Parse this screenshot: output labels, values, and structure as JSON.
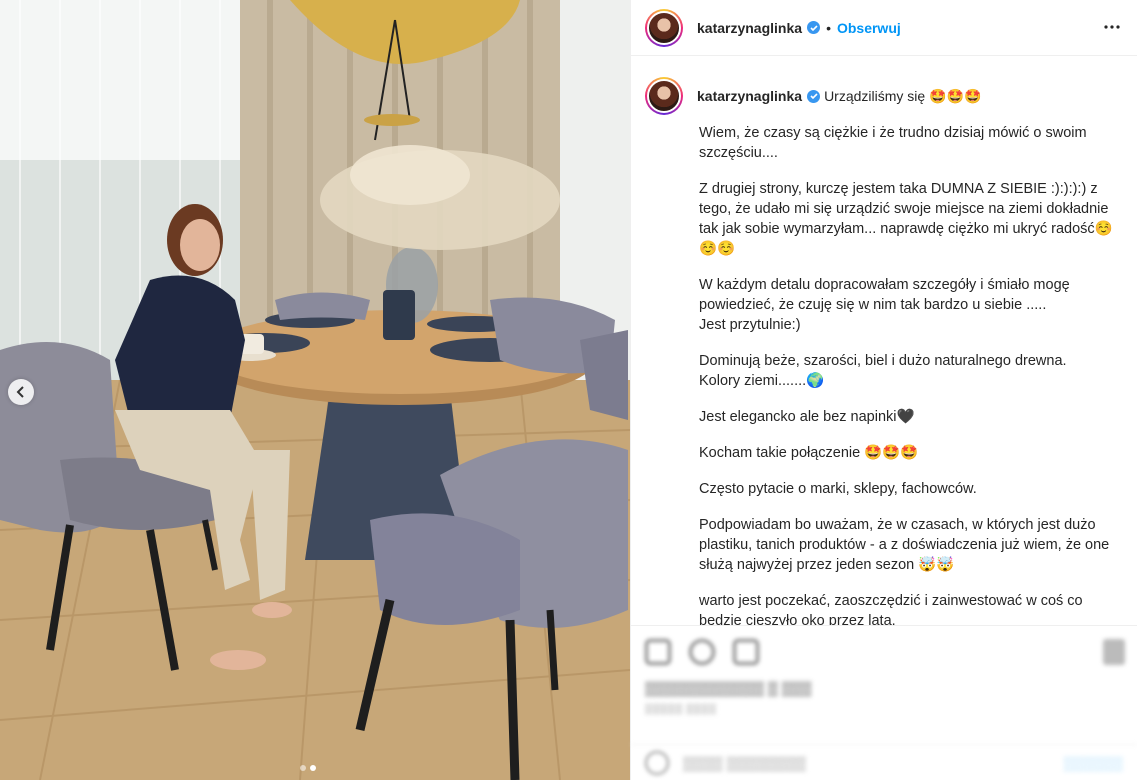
{
  "post": {
    "username": "katarzynaglinka",
    "verified": true,
    "separator": "•",
    "follow_label": "Obserwuj",
    "more_icon": "more-horizontal-icon"
  },
  "caption": {
    "username": "katarzynaglinka",
    "intro": "Urządziliśmy się 🤩🤩🤩",
    "paragraphs": [
      "Wiem, że czasy są ciężkie i że trudno dzisiaj mówić o swoim szczęściu....",
      "Z drugiej strony, kurczę jestem taka DUMNA Z SIEBIE :):):):) z tego, że udało mi się urządzić swoje miejsce na ziemi dokładnie tak jak sobie wymarzyłam... naprawdę ciężko mi ukryć radość☺️☺️☺️",
      "W każdym detalu dopracowałam szczegóły i śmiało mogę powiedzieć, że czuję się w nim tak bardzo u siebie .....\nJest przytulnie:)",
      "Dominują beże, szarości, biel i dużo naturalnego drewna.\nKolory ziemi.......🌍",
      "Jest elegancko ale bez napinki🖤",
      "Kocham takie połączenie 🤩🤩🤩",
      "Często pytacie o marki, sklepy, fachowców.",
      "Podpowiadam bo uważam, że w czasach, w których jest dużo plastiku, tanich produktów - a z doświadczenia już wiem, że one służą najwyżej przez jeden sezon 🤯🤯",
      "warto jest poczekać, zaoszczędzić i zainwestować w coś co będzie cieszyło oko przez lata."
    ]
  },
  "carousel": {
    "prev_icon": "chevron-left-icon",
    "slide_count": 2,
    "active_index": 1
  },
  "colors": {
    "link": "#0095f6",
    "verified": "#3897f0",
    "text": "#262626"
  }
}
